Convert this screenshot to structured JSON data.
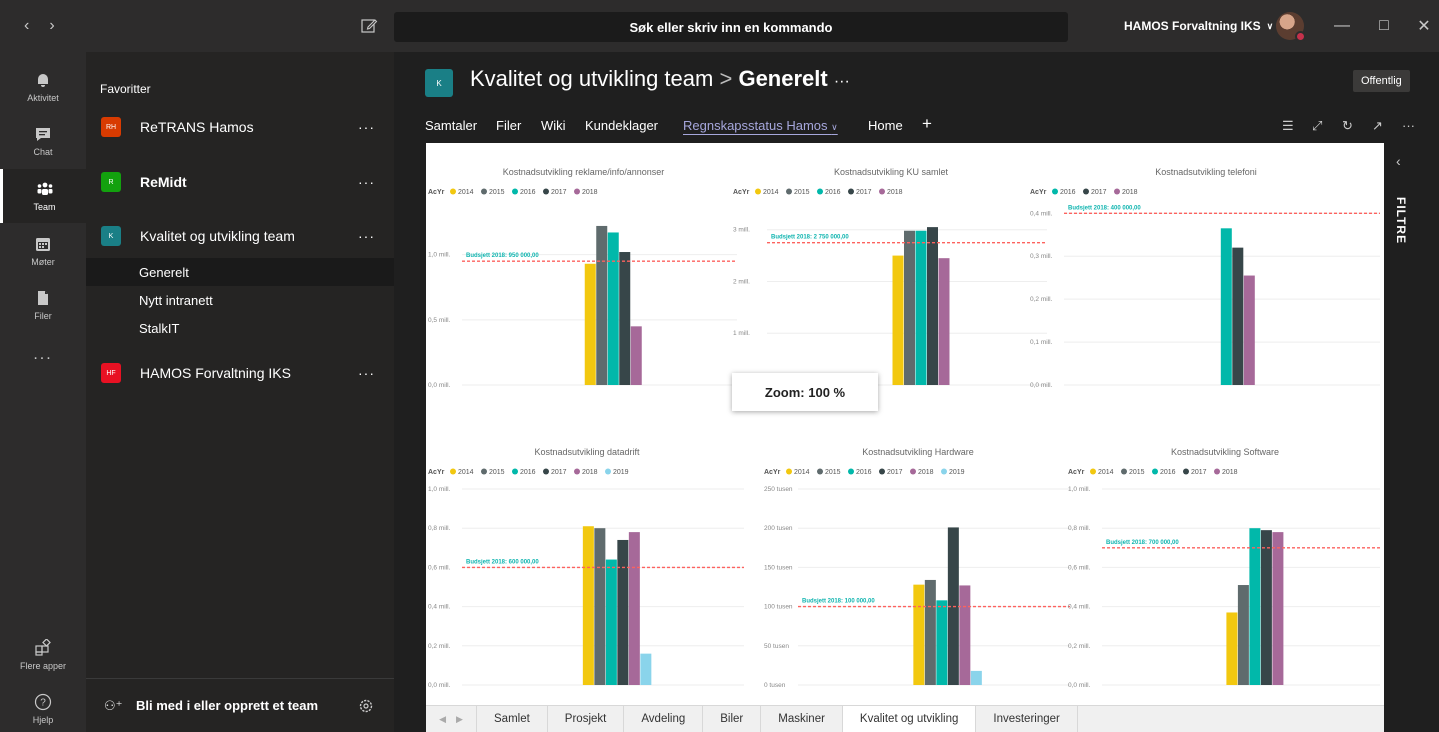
{
  "titlebar": {
    "search_placeholder": "Søk eller skriv inn en kommando",
    "org_name": "HAMOS Forvaltning IKS"
  },
  "rail": {
    "items": [
      {
        "label": "Aktivitet",
        "icon": "bell-icon"
      },
      {
        "label": "Chat",
        "icon": "chat-icon"
      },
      {
        "label": "Team",
        "icon": "teams-icon"
      },
      {
        "label": "Møter",
        "icon": "calendar-icon"
      },
      {
        "label": "Filer",
        "icon": "file-icon"
      },
      {
        "label": "...",
        "icon": "more-icon"
      }
    ],
    "more_apps": "Flere apper",
    "help": "Hjelp"
  },
  "teamlist": {
    "favorites_label": "Favoritter",
    "teams": [
      {
        "initials": "RH",
        "name": "ReTRANS Hamos",
        "color": "#d83b01"
      },
      {
        "initials": "R",
        "name": "ReMidt",
        "color": "#13a10e"
      },
      {
        "initials": "K",
        "name": "Kvalitet og utvikling team",
        "color": "#1a7f86"
      },
      {
        "initials": "HF",
        "name": "HAMOS Forvaltning IKS",
        "color": "#e81123"
      }
    ],
    "channels": [
      "Generelt",
      "Nytt intranett",
      "StalkIT"
    ],
    "join_label": "Bli med i eller opprett et team"
  },
  "header": {
    "avatar_initial": "K",
    "team_name": "Kvalitet og utvikling team",
    "separator": ">",
    "channel_name": "Generelt",
    "ellipsis": "···",
    "public_badge": "Offentlig"
  },
  "tabs": [
    "Samtaler",
    "Filer",
    "Wiki",
    "Kundeklager",
    "Regnskapsstatus Hamos",
    "Home"
  ],
  "active_tab": "Regnskapsstatus Hamos",
  "report": {
    "filters_label": "FILTRE",
    "zoom_label": "Zoom: 100 %",
    "page_tabs": [
      "Samlet",
      "Prosjekt",
      "Avdeling",
      "Biler",
      "Maskiner",
      "Kvalitet og utvikling",
      "Investeringer"
    ],
    "active_page": "Kvalitet og utvikling"
  },
  "colors": {
    "2014": "#f2c80f",
    "2015": "#5f6b6d",
    "2016": "#01b8aa",
    "2017": "#374649",
    "2018": "#a66999",
    "2019": "#8ad4eb",
    "budget": "#fd625e",
    "accent": "#a6a7dc"
  },
  "chart_data": [
    {
      "type": "bar",
      "title": "Kostnadsutvikling reklame/info/annonser",
      "legend_title": "AcYr",
      "series": [
        {
          "name": "2014",
          "value": 0.93
        },
        {
          "name": "2015",
          "value": 1.22
        },
        {
          "name": "2016",
          "value": 1.17
        },
        {
          "name": "2017",
          "value": 1.02
        },
        {
          "name": "2018",
          "value": 0.45
        }
      ],
      "y_ticks": [
        "0,0 mill.",
        "0,5 mill.",
        "1,0 mill."
      ],
      "ylim": [
        0,
        1.35
      ],
      "budget_line": {
        "value": 0.95,
        "label": "Budsjett 2018: 950 000,00"
      }
    },
    {
      "type": "bar",
      "title": "Kostnadsutvikling KU samlet",
      "legend_title": "AcYr",
      "series": [
        {
          "name": "2014",
          "value": 2.5
        },
        {
          "name": "2015",
          "value": 2.98
        },
        {
          "name": "2016",
          "value": 2.98
        },
        {
          "name": "2017",
          "value": 3.05
        },
        {
          "name": "2018",
          "value": 2.45
        }
      ],
      "y_ticks": [
        "0 mill.",
        "1 mill.",
        "2 mill.",
        "3 mill."
      ],
      "ylim": [
        0,
        3.4
      ],
      "budget_line": {
        "value": 2.75,
        "label": "Budsjett 2018: 2 750 000,00"
      }
    },
    {
      "type": "bar",
      "title": "Kostnadsutvikling  telefoni",
      "legend_title": "AcYr",
      "series": [
        {
          "name": "2016",
          "value": 0.365
        },
        {
          "name": "2017",
          "value": 0.32
        },
        {
          "name": "2018",
          "value": 0.255
        }
      ],
      "y_ticks": [
        "0,0 mill.",
        "0,1 mill.",
        "0,2 mill.",
        "0,3 mill.",
        "0,4 mill."
      ],
      "ylim": [
        0,
        0.41
      ],
      "budget_line": {
        "value": 0.4,
        "label": "Budsjett 2018: 400 000,00"
      }
    },
    {
      "type": "bar",
      "title": "Kostnadsutvikling  datadrift",
      "legend_title": "AcYr",
      "series": [
        {
          "name": "2014",
          "value": 0.81
        },
        {
          "name": "2015",
          "value": 0.8
        },
        {
          "name": "2016",
          "value": 0.64
        },
        {
          "name": "2017",
          "value": 0.74
        },
        {
          "name": "2018",
          "value": 0.78
        },
        {
          "name": "2019",
          "value": 0.16
        }
      ],
      "y_ticks": [
        "0,0 mill.",
        "0,2 mill.",
        "0,4 mill.",
        "0,6 mill.",
        "0,8 mill.",
        "1,0 mill."
      ],
      "ylim": [
        0,
        1.0
      ],
      "budget_line": {
        "value": 0.6,
        "label": "Budsjett 2018: 600 000,00"
      }
    },
    {
      "type": "bar",
      "title": "Kostnadsutvikling  Hardware",
      "legend_title": "AcYr",
      "series": [
        {
          "name": "2014",
          "value": 128
        },
        {
          "name": "2015",
          "value": 134
        },
        {
          "name": "2016",
          "value": 108
        },
        {
          "name": "2017",
          "value": 201
        },
        {
          "name": "2018",
          "value": 127
        },
        {
          "name": "2019",
          "value": 18
        }
      ],
      "y_ticks": [
        "0 tusen",
        "50 tusen",
        "100 tusen",
        "150 tusen",
        "200 tusen",
        "250 tusen"
      ],
      "ylim": [
        0,
        250
      ],
      "budget_line": {
        "value": 100,
        "label": "Budsjett 2018: 100 000,00"
      }
    },
    {
      "type": "bar",
      "title": "Kostnadsutvikling  Software",
      "legend_title": "AcYr",
      "series": [
        {
          "name": "2014",
          "value": 0.37
        },
        {
          "name": "2015",
          "value": 0.51
        },
        {
          "name": "2016",
          "value": 0.8
        },
        {
          "name": "2017",
          "value": 0.79
        },
        {
          "name": "2018",
          "value": 0.78
        }
      ],
      "y_ticks": [
        "0,0 mill.",
        "0,2 mill.",
        "0,4 mill.",
        "0,6 mill.",
        "0,8 mill.",
        "1,0 mill."
      ],
      "ylim": [
        0,
        1.0
      ],
      "budget_line": {
        "value": 0.7,
        "label": "Budsjett 2018: 700 000,00"
      }
    }
  ]
}
